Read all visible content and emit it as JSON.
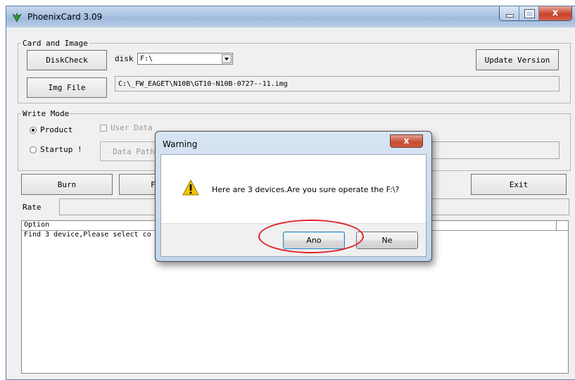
{
  "window": {
    "title": "PhoenixCard 3.09",
    "close_glyph": "x"
  },
  "card_image": {
    "legend": "Card and Image",
    "diskcheck_label": "DiskCheck",
    "disk_label": "disk",
    "disk_selected": "F:\\",
    "update_label": "Update Version",
    "img_file_label": "Img File",
    "img_path": "C:\\_FW_EAGET\\N10B\\GT10-N10B-0727--11.img"
  },
  "write_mode": {
    "legend": "Write Mode",
    "product_label": "Product",
    "product_selected": true,
    "user_data_label": "User Data",
    "startup_label": "Startup !",
    "data_path_label": "Data Path"
  },
  "actions": {
    "burn_label": "Burn",
    "format_label": "For",
    "exit_label": "Exit"
  },
  "rate_label": "Rate",
  "log": {
    "header": "Option",
    "rows": [
      "Find 3 device,Please select co"
    ]
  },
  "dialog": {
    "title": "Warning",
    "close_glyph": "x",
    "message": "Here are 3 devices.Are you sure operate the F:\\?",
    "yes_label": "Ano",
    "no_label": "Ne"
  },
  "colors": {
    "highlight": "#e0202a",
    "warning_icon": "#f2c200"
  }
}
